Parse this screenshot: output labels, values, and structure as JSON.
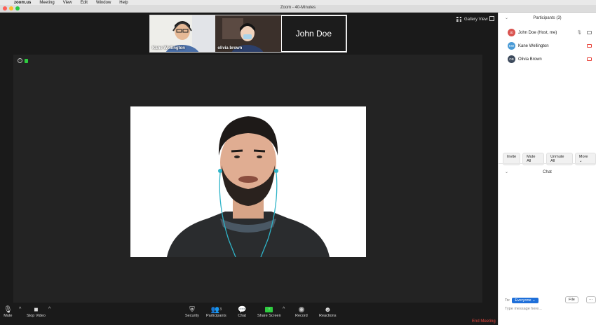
{
  "menubar": {
    "apple": "",
    "app": "zoom.us",
    "items": [
      "Meeting",
      "View",
      "Edit",
      "Window",
      "Help"
    ]
  },
  "window": {
    "title": "Zoom - 40-Minutes"
  },
  "gallery": {
    "tiles": [
      {
        "name": "Kane Wellington"
      },
      {
        "name": "olivia brown"
      },
      {
        "name": "John Doe"
      }
    ],
    "view_label": "Gallery View"
  },
  "toolbar": {
    "mute": "Mute",
    "stop_video": "Stop Video",
    "security": "Security",
    "participants": "Participants",
    "participants_count": "3",
    "chat": "Chat",
    "share_screen": "Share Screen",
    "record": "Record",
    "reactions": "Reactions",
    "end": "End Meeting"
  },
  "panel": {
    "title": "Participants (3)",
    "participants": [
      {
        "initials": "JD",
        "name": "John Doe (Host, me)",
        "color": "#d9534f",
        "video_off": false
      },
      {
        "initials": "KW",
        "name": "Kane Wellington",
        "color": "#4a9bd6",
        "video_off": true
      },
      {
        "initials": "OB",
        "name": "Olivia Brown",
        "color": "#3d4a5c",
        "video_off": true
      }
    ],
    "buttons": {
      "invite": "Invite",
      "mute_all": "Mute All",
      "unmute_all": "Unmute All",
      "more": "More ⌄"
    },
    "chat_title": "Chat",
    "to_label": "To:",
    "to_value": "Everyone ⌄",
    "file_label": "File",
    "more_label": "···",
    "placeholder": "Type message here..."
  },
  "colors": {
    "accent": "#1e6fd9",
    "end": "#e8453c",
    "secure": "#2ecc40"
  }
}
